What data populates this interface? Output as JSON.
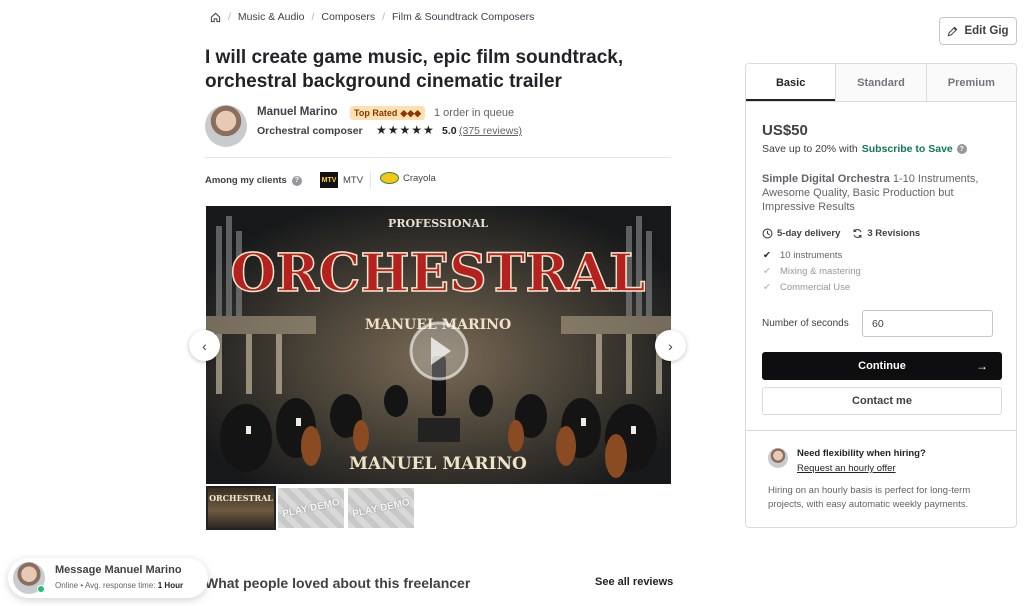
{
  "breadcrumb": {
    "home_icon": "home-icon",
    "items": [
      "Music & Audio",
      "Composers",
      "Film & Soundtrack Composers"
    ]
  },
  "edit_gig": {
    "label": "Edit Gig",
    "icon": "pencil-icon"
  },
  "gig": {
    "title": "I will create game music, epic film soundtrack, orchestral background cinematic trailer"
  },
  "seller": {
    "name": "Manuel Marino",
    "badge": "Top Rated",
    "badge_diamonds": "◆◆◆",
    "queue": "1 order in queue",
    "role": "Orchestral composer",
    "stars": "★★★★★",
    "rating": "5.0",
    "reviews": "(375 reviews)"
  },
  "clients": {
    "label": "Among my clients",
    "items": [
      {
        "name": "MTV",
        "logo_text": "MTV"
      },
      {
        "name": "Crayola"
      }
    ]
  },
  "gallery": {
    "poster_small": "PROFESSIONAL",
    "poster_title": "ORCHESTRAL",
    "poster_subtitle": "MANUEL MARINO",
    "poster_footer": "MANUEL MARINO",
    "thumbs": [
      {
        "label": "ORCHESTRAL"
      },
      {
        "label": "PLAY DEMO"
      },
      {
        "label": "PLAY DEMO"
      }
    ]
  },
  "reviews_section": {
    "title": "What people loved about this freelancer",
    "see_all": "See all reviews"
  },
  "message": {
    "title": "Message Manuel Marino",
    "online": "Online",
    "dot": "•",
    "response_label": "Avg. response time:",
    "response_value": "1 Hour"
  },
  "package": {
    "tabs": [
      "Basic",
      "Standard",
      "Premium"
    ],
    "active_tab": "Basic",
    "price": "US$50",
    "save_text": "Save up to 20% with",
    "save_link": "Subscribe to Save",
    "desc_bold": "Simple Digital Orchestra",
    "desc_rest": " 1-10 Instruments, Awesome Quality, Basic Production but Impressive Results",
    "delivery": "5-day delivery",
    "revisions": "3 Revisions",
    "features": [
      {
        "label": "10 instruments",
        "included": true
      },
      {
        "label": "Mixing & mastering",
        "included": false
      },
      {
        "label": "Commercial Use",
        "included": false
      }
    ],
    "seconds_label": "Number of seconds",
    "seconds_value": "60",
    "continue_label": "Continue",
    "contact_label": "Contact me"
  },
  "hourly": {
    "title": "Need flexibility when hiring?",
    "link": "Request an hourly offer",
    "desc": "Hiring on an hourly basis is perfect for long-term projects, with easy automatic weekly payments."
  },
  "colors": {
    "accent_green": "#0d7a54",
    "badge_bg": "#ffe0b3",
    "badge_text": "#8b3800",
    "online": "#1dbf73",
    "button_dark": "#0e0e10"
  }
}
